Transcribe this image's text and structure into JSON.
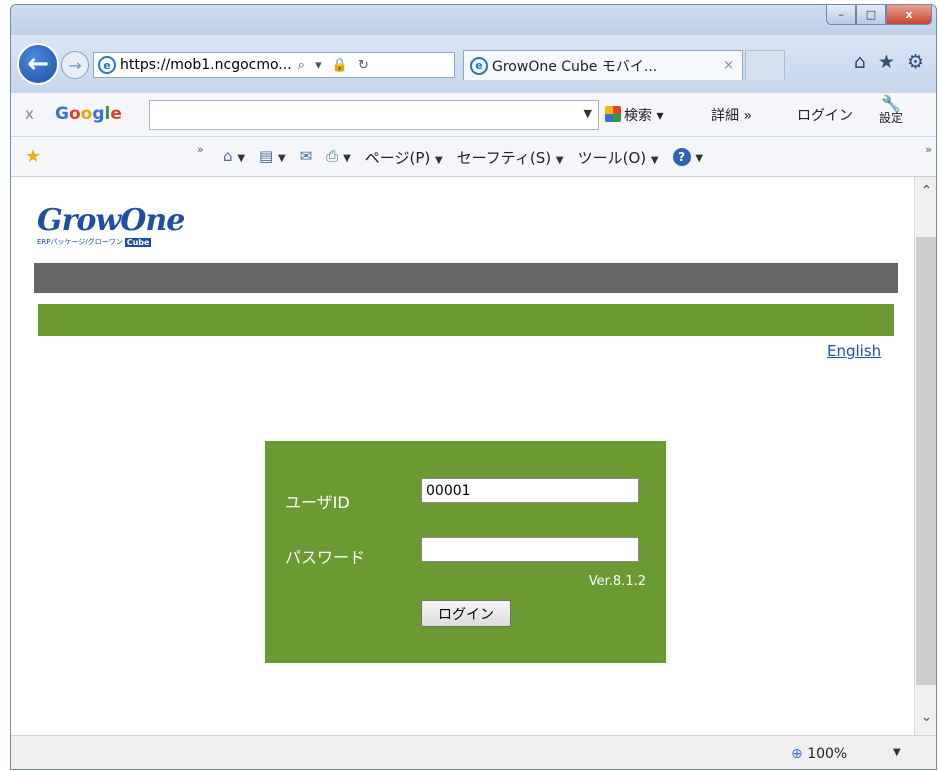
{
  "browser": {
    "address": {
      "proto": "https://",
      "rest": "mob1.ncgocmo...",
      "icons": "⌕ ▾ 🔒 ↻"
    },
    "tab": {
      "title": "GrowOne Cube モバイ...",
      "close": "×"
    },
    "window_controls": {
      "minimize": "–",
      "maximize": "□",
      "close": "x"
    }
  },
  "google_bar": {
    "close": "x",
    "logo": {
      "G": "G",
      "o1": "o",
      "o2": "o",
      "g": "g",
      "l": "l",
      "e": "e"
    },
    "search_label": "検索",
    "more_label": "詳細 »",
    "login_label": "ログイン",
    "settings_label": "設定"
  },
  "command_bar": {
    "page_label": "ページ(P)",
    "safety_label": "セーフティ(S)",
    "tools_label": "ツール(O)"
  },
  "page": {
    "logo_text": "GrowOne",
    "logo_subtitle": "ERPパッケージ/グローワン",
    "logo_cube": "Cube",
    "english_link": "English",
    "login": {
      "user_label": "ユーザID",
      "user_value": "00001",
      "password_label": "パスワード",
      "password_value": "",
      "version": "Ver.8.1.2",
      "login_button": "ログイン"
    }
  },
  "status_bar": {
    "zoom": "100%"
  },
  "colors": {
    "accent_green": "#6b9a33",
    "gray_bar": "#666666",
    "logo_blue": "#1e4fa3"
  }
}
